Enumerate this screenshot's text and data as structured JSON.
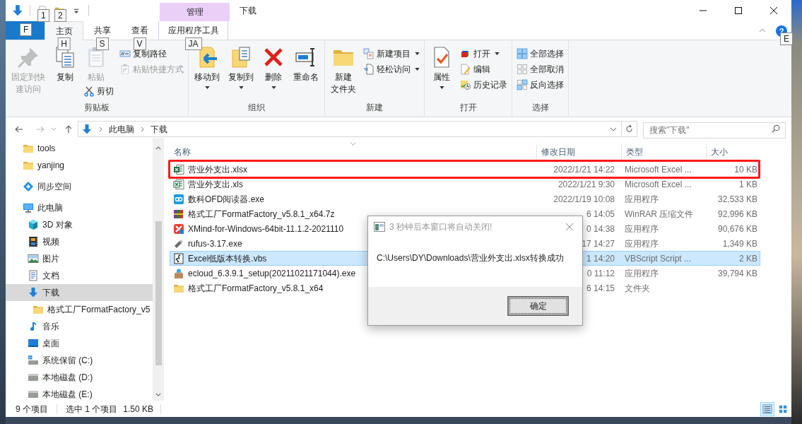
{
  "quick_access_toolbar": [
    {
      "kind": "download"
    },
    {
      "kind": "properties",
      "key_tip": "1"
    },
    {
      "kind": "new-folder",
      "key_tip": "2"
    },
    {
      "kind": "customize"
    }
  ],
  "context_tab_header": {
    "label": "管理"
  },
  "window": {
    "title": "下载"
  },
  "tabs": [
    {
      "kind": "file",
      "key_tip": "F",
      "selected": false
    },
    {
      "kind": "normal",
      "label": "主页",
      "key_tip": "H",
      "selected": true
    },
    {
      "kind": "normal",
      "label": "共享",
      "key_tip": "S",
      "selected": false
    },
    {
      "kind": "normal",
      "label": "查看",
      "key_tip": "V",
      "selected": false
    },
    {
      "kind": "context",
      "label": "应用程序工具",
      "key_tip": "JA",
      "selected": false
    }
  ],
  "help": {
    "label": "?",
    "key_tip": "E"
  },
  "ribbon_groups": [
    {
      "label": "剪贴板",
      "columns": [
        [
          {
            "lines": [
              "固定到快",
              "速访问"
            ],
            "disabled": true,
            "dropdown": false
          }
        ],
        [
          {
            "lines": [
              "复制"
            ],
            "disabled": false,
            "dropdown": false
          }
        ],
        [
          {
            "lines": [
              "粘贴"
            ],
            "disabled": true,
            "dropdown": false
          },
          {
            "lines": [
              "剪切"
            ],
            "disabled": false,
            "dropdown": false
          }
        ],
        [
          {
            "lines": [
              "复制路径"
            ],
            "disabled": false,
            "dropdown": false
          },
          {
            "lines": [
              "粘贴快捷方式"
            ],
            "disabled": true,
            "dropdown": false
          }
        ]
      ]
    },
    {
      "label": "组织",
      "columns": [
        [
          {
            "lines": [
              "移动到"
            ],
            "disabled": false,
            "dropdown": true
          }
        ],
        [
          {
            "lines": [
              "复制到"
            ],
            "disabled": false,
            "dropdown": true
          }
        ],
        [
          {
            "lines": [
              "删除"
            ],
            "disabled": false,
            "dropdown": true
          }
        ],
        [
          {
            "lines": [
              "重命名"
            ],
            "disabled": false,
            "dropdown": false
          }
        ]
      ]
    },
    {
      "label": "新建",
      "columns": [
        [
          {
            "lines": [
              "新建",
              "文件夹"
            ],
            "disabled": false,
            "dropdown": false
          }
        ],
        [
          {
            "lines": [
              "新建项目"
            ],
            "disabled": false,
            "dropdown": true
          },
          {
            "lines": [
              "轻松访问"
            ],
            "disabled": false,
            "dropdown": true
          }
        ]
      ]
    },
    {
      "label": "打开",
      "columns": [
        [
          {
            "lines": [
              "属性"
            ],
            "disabled": false,
            "dropdown": true
          }
        ],
        [
          {
            "lines": [
              "打开"
            ],
            "disabled": false,
            "dropdown": true
          },
          {
            "lines": [
              "编辑"
            ],
            "disabled": false,
            "dropdown": false
          },
          {
            "lines": [
              "历史记录"
            ],
            "disabled": false,
            "dropdown": false
          }
        ]
      ]
    },
    {
      "label": "选择",
      "columns": [
        [
          {
            "lines": [
              "全部选择"
            ],
            "disabled": false,
            "dropdown": false
          },
          {
            "lines": [
              "全部取消"
            ],
            "disabled": false,
            "dropdown": false
          },
          {
            "lines": [
              "反向选择"
            ],
            "disabled": false,
            "dropdown": false
          }
        ]
      ]
    }
  ],
  "address_bar": {
    "path": [
      "此电脑",
      "下载"
    ]
  },
  "search": {
    "placeholder": "搜索\"下载\""
  },
  "navigation": [
    {
      "label": "tools",
      "kind": "folder",
      "selected": false
    },
    {
      "label": "yanjing",
      "kind": "folder",
      "selected": false
    },
    {
      "label": "同步空间",
      "kind": "sync",
      "selected": false
    },
    {
      "label": "此电脑",
      "kind": "pc",
      "selected": false,
      "children": [
        {
          "label": "3D 对象",
          "kind": "cube",
          "selected": false
        },
        {
          "label": "视频",
          "kind": "video",
          "selected": false
        },
        {
          "label": "图片",
          "kind": "pictures",
          "selected": false
        },
        {
          "label": "文档",
          "kind": "docs",
          "selected": false
        },
        {
          "label": "下载",
          "kind": "download",
          "selected": true,
          "children": [
            {
              "label": "格式工厂FormatFactory_v5",
              "kind": "folder",
              "selected": false
            }
          ]
        },
        {
          "label": "音乐",
          "kind": "music",
          "selected": false
        },
        {
          "label": "桌面",
          "kind": "desktop",
          "selected": false
        },
        {
          "label": "系统保留 (C:)",
          "kind": "drive-system",
          "selected": false
        },
        {
          "label": "本地磁盘 (D:)",
          "kind": "drive",
          "selected": false
        },
        {
          "label": "本地磁盘 (E:)",
          "kind": "drive",
          "selected": false
        }
      ]
    }
  ],
  "files": {
    "columns": [
      "名称",
      "修改日期",
      "类型",
      "大小"
    ],
    "rows": [
      {
        "name": "营业外支出.xlsx",
        "date": "2022/1/21 14:22",
        "type": "Microsoft Excel ...",
        "size": "10 KB",
        "kind": "excel",
        "selected": false,
        "annotated": true
      },
      {
        "name": "营业外支出.xls",
        "date": "2022/1/21 9:30",
        "type": "Microsoft Excel ...",
        "size": "1 KB",
        "kind": "excel-old",
        "selected": false,
        "annotated": false
      },
      {
        "name": "数科OFD阅读器.exe",
        "date": "2022/1/19 10:08",
        "type": "应用程序",
        "size": "32,533 KB",
        "kind": "ofd",
        "selected": false,
        "annotated": false
      },
      {
        "name": "格式工厂FormatFactory_v5.8.1_x64.7z",
        "date": "6 14:05",
        "type": "WinRAR 压缩文件",
        "size": "92,996 KB",
        "kind": "archive",
        "selected": false,
        "annotated": false
      },
      {
        "name": "XMind-for-Windows-64bit-11.1.2-2021110",
        "date": "0 14:38",
        "type": "应用程序",
        "size": "90,676 KB",
        "kind": "xmind",
        "selected": false,
        "annotated": false
      },
      {
        "name": "rufus-3.17.exe",
        "date": "17 14:27",
        "type": "应用程序",
        "size": "1,349 KB",
        "kind": "usb",
        "selected": false,
        "annotated": false
      },
      {
        "name": "Excel低版本转换.vbs",
        "date": "1 14:20",
        "type": "VBScript Script ...",
        "size": "2 KB",
        "kind": "script",
        "selected": true,
        "annotated": false
      },
      {
        "name": "ecloud_6.3.9.1_setup(20211021171044).exe",
        "date": "0 11:12",
        "type": "应用程序",
        "size": "39,794 KB",
        "kind": "installer",
        "selected": false,
        "annotated": false
      },
      {
        "name": "格式工厂FormatFactory_v5.8.1_x64",
        "date": "6 14:15",
        "type": "文件夹",
        "kind": "folder",
        "selected": false,
        "annotated": false
      }
    ]
  },
  "dialog": {
    "title": "3 秒钟后本窗口将自动关闭!",
    "message": "C:\\Users\\DY\\Downloads\\营业外支出.xlsx转换成功",
    "button": "确定"
  },
  "status_bar": {
    "item_count": "9 个项目",
    "selection": "选中 1 个项目",
    "selection_size": "1.50 KB",
    "views": [
      {
        "kind": "details",
        "selected": true
      },
      {
        "kind": "tiles",
        "selected": false
      }
    ]
  }
}
